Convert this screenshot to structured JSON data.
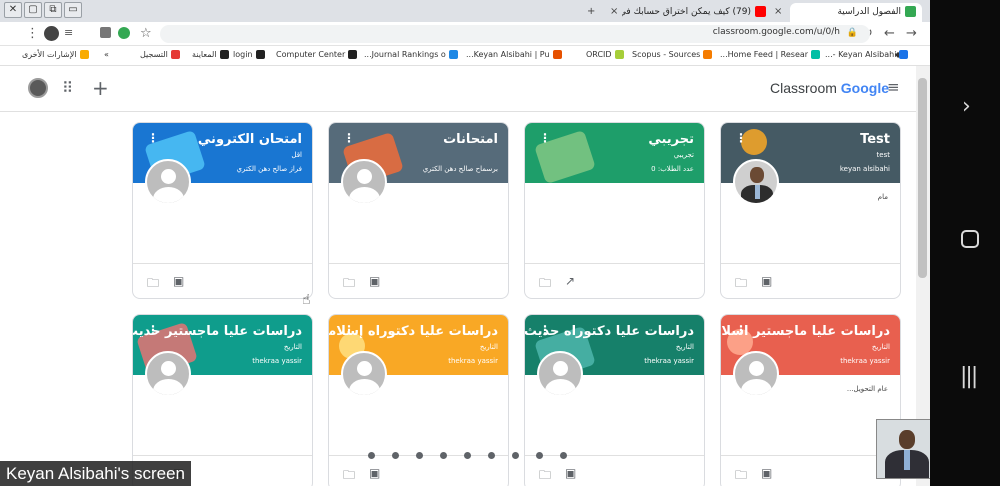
{
  "browser": {
    "tabs": [
      {
        "label": "الفصول الدراسية",
        "favicon_color": "#34a853",
        "active": true
      },
      {
        "label": "(79) كيف يمكن اختراق حسابك في wh",
        "favicon_color": "#ff0000",
        "active": false
      }
    ],
    "new_tab_label": "+",
    "close_label": "×",
    "url": "classroom.google.com/u/0/h",
    "bookmarks": [
      {
        "label": "التسجيل",
        "color": "#e53935"
      },
      {
        "label": "المعاينة",
        "color": "#212121"
      },
      {
        "label": "login",
        "color": "#212121"
      },
      {
        "label": "Computer Center",
        "color": "#212121"
      },
      {
        "label": "Journal Rankings o...",
        "color": "#1e88e5"
      },
      {
        "label": "Keyan Alsibahi | Pu...",
        "color": "#e65100"
      },
      {
        "label": "ORCID",
        "color": "#a6ce39"
      },
      {
        "label": "Scopus - Sources",
        "color": "#f57c00"
      },
      {
        "label": "Home Feed | Resear...",
        "color": "#00bfa5"
      },
      {
        "label": "Keyan Alsibahi -...",
        "color": "#1a73e8"
      },
      {
        "label": "الإشارات الأخرى",
        "color": "#f9ab00"
      }
    ]
  },
  "classroom": {
    "brand_prefix": "Classroom",
    "brand_suffix": "Google"
  },
  "cards": [
    {
      "title": "Test",
      "section": "test",
      "teacher": "keyan alsibahi",
      "note": "مام",
      "color": "#455a64",
      "deco": "#f9a825",
      "photo": "real",
      "footer_icons": [
        "📁",
        "▣"
      ]
    },
    {
      "title": "تجريبي",
      "section": "تجريبي",
      "teacher": "عدد الطلاب: 0",
      "note": "",
      "color": "#1e9e6a",
      "deco": "#81c784",
      "photo": "none",
      "footer_icons": [
        "📁",
        "↗"
      ]
    },
    {
      "title": "امتحانات",
      "section": "",
      "teacher": "برسماح صالح دهن الكتري",
      "note": "",
      "color": "#566b7a",
      "deco": "#ef6c3a",
      "photo": "blank",
      "footer_icons": [
        "📁",
        "▣"
      ]
    },
    {
      "title": "امتحان الكتروني",
      "section": "اقل",
      "teacher": "فراز صالح دهن الكتري",
      "note": "",
      "color": "#1976d2",
      "deco": "#4fc3f7",
      "photo": "blank",
      "footer_icons": [
        "📁",
        "▣"
      ]
    },
    {
      "title": "دراسات عليا ماجستير اسلامي",
      "section": "التاريخ",
      "teacher": "thekraa yassir",
      "note": "عام التحويل...",
      "color": "#e8604f",
      "deco": "#ffab91",
      "photo": "blank",
      "footer_icons": [
        "📁",
        "▣"
      ]
    },
    {
      "title": "دراسات عليا دكتوراه حديث",
      "section": "التاريخ",
      "teacher": "thekraa yassir",
      "note": "",
      "color": "#16806a",
      "deco": "#4db6ac",
      "photo": "blank",
      "footer_icons": [
        "📁",
        "▣"
      ]
    },
    {
      "title": "دراسات عليا دكتوراه إسلامي",
      "section": "التاريخ",
      "teacher": "thekraa yassir",
      "note": "",
      "color": "#f9a825",
      "deco": "#ffe082",
      "photo": "blank",
      "footer_icons": [
        "📁",
        "▣"
      ]
    },
    {
      "title": "دراسات عليا ماجستير حديث",
      "section": "التاريخ",
      "teacher": "thekraa yassir",
      "note": "",
      "color": "#0f9d8c",
      "deco": "#e57373",
      "photo": "blank",
      "footer_icons": [
        "📁",
        "▣"
      ]
    }
  ],
  "meeting": {
    "screen_label": "Keyan Alsibahi's screen",
    "pagination_dots": 9
  },
  "colors": {
    "tabstrip": "#dee1e6",
    "scroll_thumb": "#c1c1c1"
  }
}
